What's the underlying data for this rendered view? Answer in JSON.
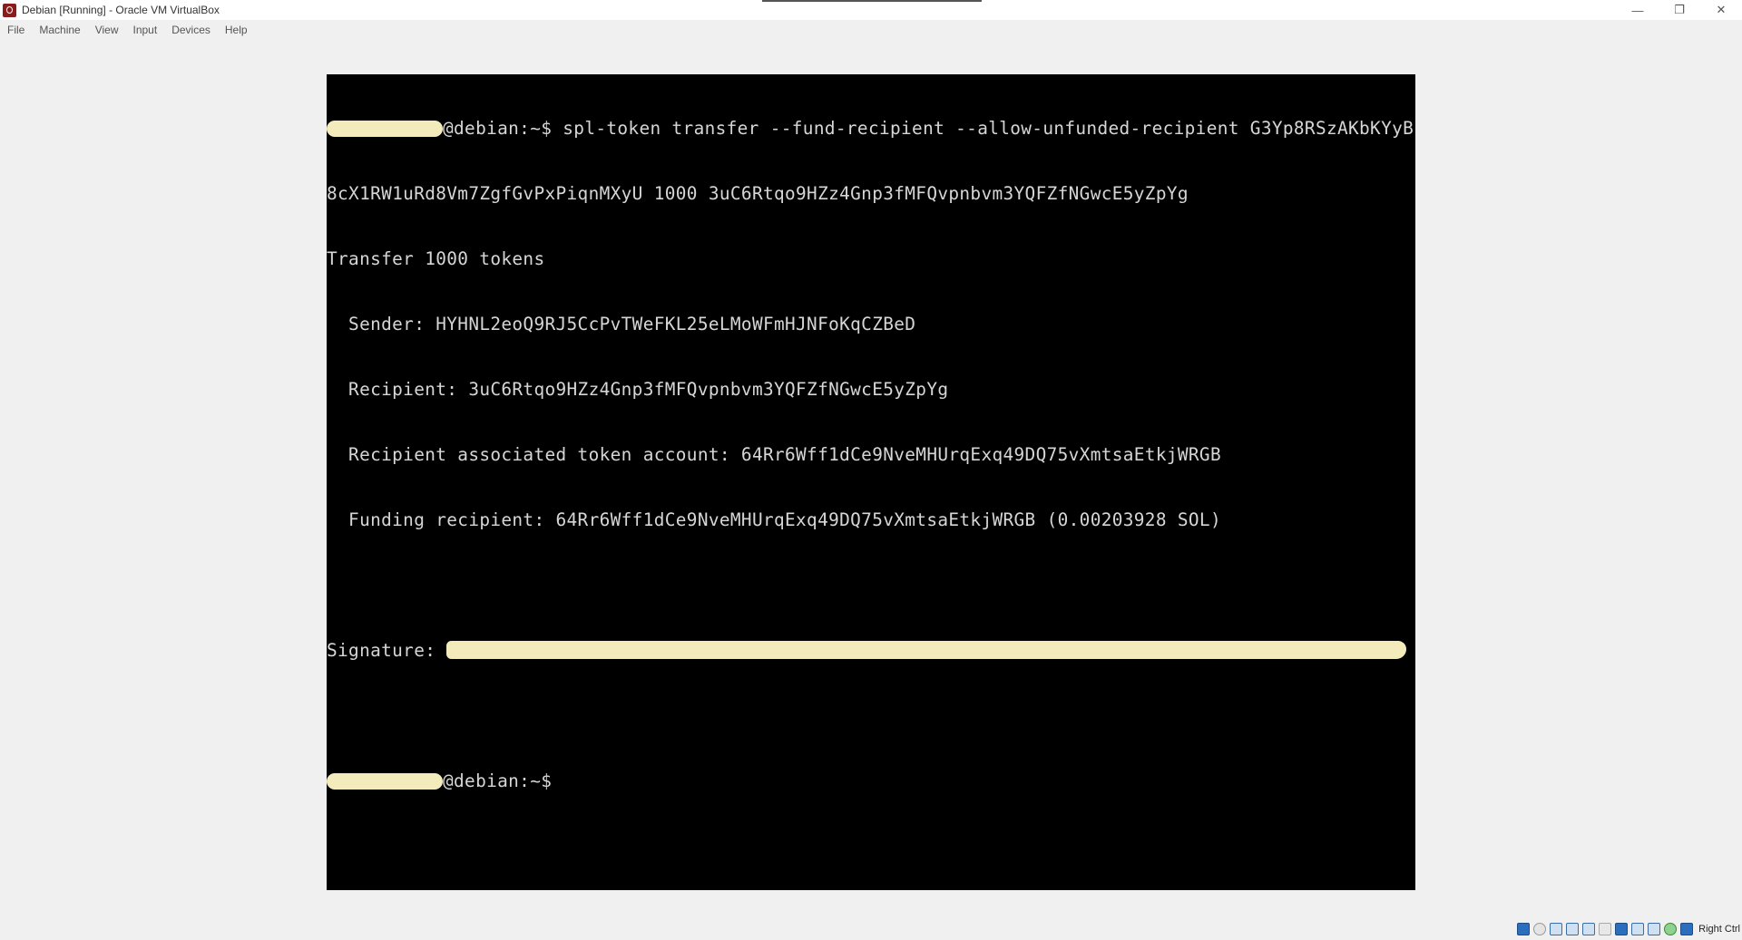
{
  "window": {
    "title": "Debian [Running] - Oracle VM VirtualBox",
    "controls": {
      "minimize": "—",
      "restore": "❐",
      "close": "✕"
    }
  },
  "menu": [
    "File",
    "Machine",
    "View",
    "Input",
    "Devices",
    "Help"
  ],
  "terminal": {
    "prompt_suffix": "@debian:~$",
    "command": " spl-token transfer --fund-recipient --allow-unfunded-recipient G3Yp8RSzAKbKYyB",
    "command_wrap": "8cX1RW1uRd8Vm7ZgfGvPxPiqnMXyU 1000 3uC6Rtqo9HZz4Gnp3fMFQvpnbvm3YQFZfNGwcE5yZpYg",
    "output": [
      "Transfer 1000 tokens",
      "  Sender: HYHNL2eoQ9RJ5CcPvTWeFKL25eLMoWFmHJNFoKqCZBeD",
      "  Recipient: 3uC6Rtqo9HZz4Gnp3fMFQvpnbvm3YQFZfNGwcE5yZpYg",
      "  Recipient associated token account: 64Rr6Wff1dCe9NveMHUrqExq49DQ75vXmtsaEtkjWRGB",
      "  Funding recipient: 64Rr6Wff1dCe9NveMHUrqExq49DQ75vXmtsaEtkjWRGB (0.00203928 SOL)"
    ],
    "signature_label": "Signature: ",
    "final_prompt": "@debian:~$"
  },
  "statusbar": {
    "host_key": "Right Ctrl",
    "icons": [
      "hard-disk-icon",
      "optical-drive-icon",
      "audio-icon",
      "network-icon",
      "usb-icon",
      "shared-folders-icon",
      "display-icon",
      "video-capture-icon",
      "cpu-icon",
      "guest-additions-icon",
      "mouse-integration-icon"
    ]
  },
  "colors": {
    "terminal_bg": "#000000",
    "terminal_fg": "#d6d6d6",
    "redaction": "#f4ebbd",
    "chrome_bg": "#f0f0f0"
  }
}
